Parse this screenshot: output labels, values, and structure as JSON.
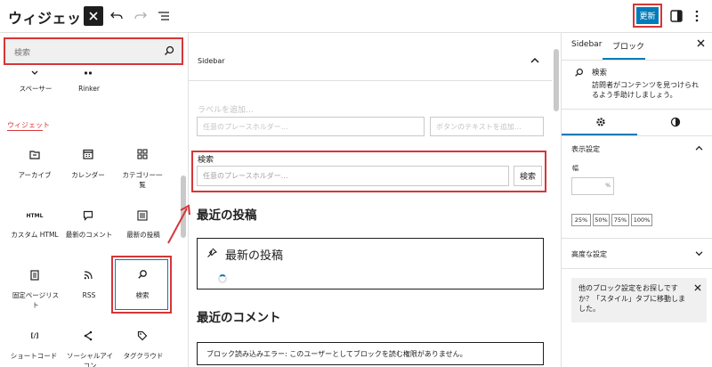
{
  "app": {
    "title": "ウィジェット"
  },
  "toolbar": {
    "update_label": "更新"
  },
  "inserter": {
    "search_placeholder": "検索",
    "top_blocks": [
      {
        "label": "スペーサー"
      },
      {
        "label": "Rinker"
      }
    ],
    "section_title": "ウィジェット",
    "blocks": [
      {
        "label": "アーカイブ",
        "icon": "archive-icon"
      },
      {
        "label": "カレンダー",
        "icon": "calendar-icon"
      },
      {
        "label": "カテゴリー一覧",
        "icon": "categories-icon"
      },
      {
        "label": "カスタム HTML",
        "icon": "html-icon",
        "icon_text": "HTML"
      },
      {
        "label": "最新のコメント",
        "icon": "comment-icon"
      },
      {
        "label": "最新の投稿",
        "icon": "posts-list-icon"
      },
      {
        "label": "固定ページリスト",
        "icon": "pages-icon"
      },
      {
        "label": "RSS",
        "icon": "rss-icon"
      },
      {
        "label": "検索",
        "icon": "search-icon"
      },
      {
        "label": "ショートコード",
        "icon": "shortcode-icon",
        "icon_text": "[/]"
      },
      {
        "label": "ソーシャルアイコン",
        "icon": "share-icon"
      },
      {
        "label": "タグクラウド",
        "icon": "tag-icon"
      }
    ]
  },
  "canvas": {
    "panel_title": "Sidebar",
    "faded_label": "ラベルを追加…",
    "faded_input_placeholder": "任意のプレースホルダー…",
    "faded_button_placeholder": "ボタンのテキストを追加…",
    "search_block": {
      "label": "検索",
      "placeholder": "任意のプレースホルダー…",
      "button": "検索"
    },
    "recent_posts_heading": "最近の投稿",
    "recent_posts_box_title": "最新の投稿",
    "recent_comments_heading": "最近のコメント",
    "error_text": "ブロック読み込みエラー: このユーザーとしてブロックを読む権限がありません。"
  },
  "settings": {
    "tabs": [
      "Sidebar",
      "ブロック"
    ],
    "block_name": "検索",
    "block_description": "訪問者がコンテンツを見つけられるよう手助けしましょう。",
    "display_settings_title": "表示設定",
    "width_label": "幅",
    "width_unit": "%",
    "percent_options": [
      "25%",
      "50%",
      "75%",
      "100%"
    ],
    "advanced_title": "高度な設定",
    "notice_text": "他のブロック設定をお探しですか？「スタイル」タブに移動しました。"
  },
  "colors": {
    "accent": "#007cba",
    "highlight": "#d63638"
  }
}
